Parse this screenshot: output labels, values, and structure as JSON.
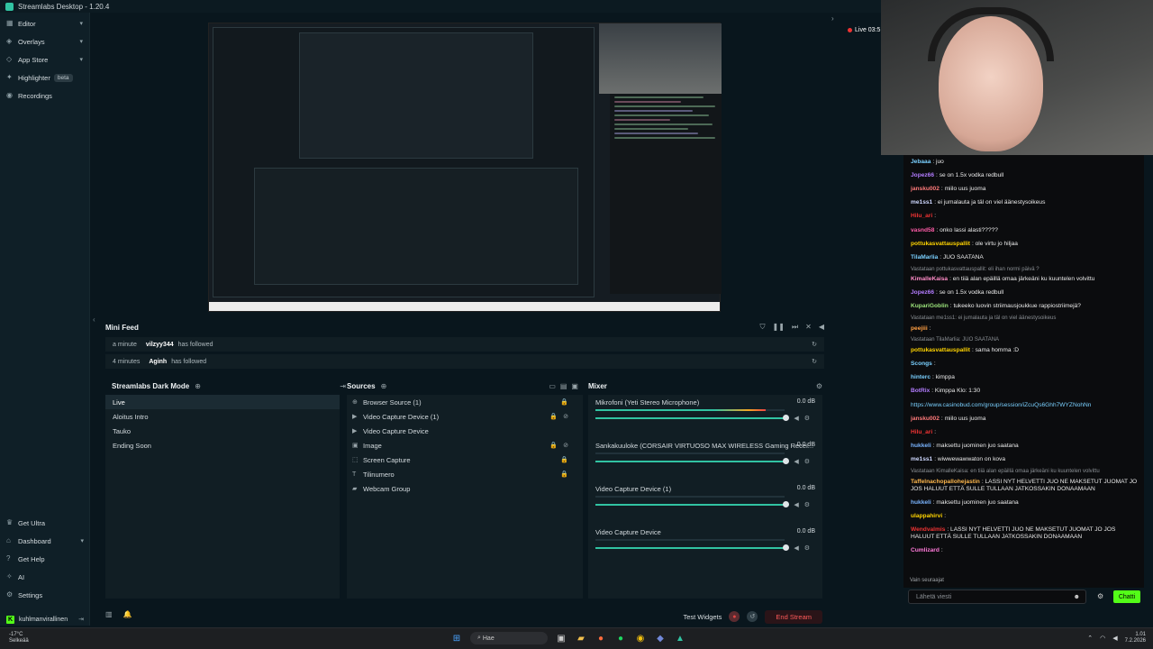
{
  "app": {
    "title": "Streamlabs Desktop - 1.20.4"
  },
  "sidebar": {
    "items": [
      {
        "label": "Editor",
        "icon": "editor-icon"
      },
      {
        "label": "Overlays",
        "icon": "overlays-icon"
      },
      {
        "label": "App Store",
        "icon": "store-icon"
      },
      {
        "label": "Highlighter",
        "icon": "highlighter-icon",
        "badge": "beta"
      },
      {
        "label": "Recordings",
        "icon": "recordings-icon"
      }
    ],
    "bottom": [
      {
        "label": "Get Ultra"
      },
      {
        "label": "Dashboard"
      },
      {
        "label": "Get Help"
      },
      {
        "label": "AI"
      },
      {
        "label": "Settings"
      }
    ],
    "user": "kuhlmanvirallinen"
  },
  "minifeed": {
    "title": "Mini Feed",
    "events": [
      {
        "time": "a minute",
        "user": "vilzyy344",
        "text": "has followed"
      },
      {
        "time": "4 minutes",
        "user": "Aginh",
        "text": "has followed"
      }
    ]
  },
  "scenes": {
    "title": "Streamlabs Dark Mode",
    "items": [
      "Live",
      "Aloitus Intro",
      "Tauko",
      "Ending Soon"
    ]
  },
  "sources": {
    "title": "Sources",
    "items": [
      "Browser Source (1)",
      "Video Capture Device (1)",
      "Video Capture Device",
      "Image",
      "Screen Capture",
      "Tilinumero",
      "Webcam Group"
    ]
  },
  "mixer": {
    "title": "Mixer",
    "channels": [
      {
        "name": "Mikrofoni (Yeti Stereo Microphone)",
        "db": "0.0 dB",
        "level": 0.9
      },
      {
        "name": "Sankakuuloke (CORSAIR VIRTUOSO MAX WIRELESS Gaming Recei...",
        "db": "0.0 dB",
        "level": 0.0
      },
      {
        "name": "Video Capture Device (1)",
        "db": "0.0 dB",
        "level": 0.0
      },
      {
        "name": "Video Capture Device",
        "db": "0.0 dB",
        "level": 0.0
      }
    ]
  },
  "footer": {
    "test_widgets": "Test Widgets",
    "end_stream": "End Stream"
  },
  "overlay": {
    "live": "Live 03:5"
  },
  "chat": {
    "messages": [
      {
        "user": "Jebaaa",
        "color": "#7ad0ff",
        "text": "juo"
      },
      {
        "user": "Jopez66",
        "color": "#b37cff",
        "text": "se on 1.5x vodka redbull"
      },
      {
        "user": "jansku002",
        "color": "#ff7a7a",
        "text": "miilo uus juoma"
      },
      {
        "user": "me1ss1",
        "color": "#cfd8ff",
        "text": "ei jumalauta ja täl on viel äänestysoikeus"
      },
      {
        "user": "Hilu_ari",
        "color": "#e33",
        "text": ""
      },
      {
        "user": "vasnd58",
        "color": "#ff5ca8",
        "text": "onko lassi alasti?????"
      },
      {
        "user": "pottukasvattauspallit",
        "color": "#ffd400",
        "text": "ole virtu jo hiljaa"
      },
      {
        "user": "TilaMarlia",
        "color": "#7ad0ff",
        "text": "JUO SAATANA"
      },
      {
        "reply": "Vastataan pottukasvattauspallit: eli ihan normi päivä ?"
      },
      {
        "user": "KimalleKaisa",
        "color": "#ff8cc8",
        "text": "en tiiä alan epäillä omaa järkeäni ku kuuntelen volvittu"
      },
      {
        "user": "Jopez66",
        "color": "#b37cff",
        "text": "se on 1.5x vodka redbull"
      },
      {
        "user": "KupariGoblin",
        "color": "#9be37b",
        "text": "tukeeko luovin striimausjoukkue rappiostriimejä?"
      },
      {
        "reply": "Vastataan me1ss1: ei jumalauta ja täl on viel äänestysoikeus"
      },
      {
        "user": "peejiii",
        "color": "#ff9f43",
        "text": ""
      },
      {
        "reply": "Vastataan TilaMarlia:  JUO SAATANA"
      },
      {
        "user": "pottukasvattauspallit",
        "color": "#ffd400",
        "text": "sama homma :D"
      },
      {
        "user": "Scongs",
        "color": "#7ad0ff",
        "text": ""
      },
      {
        "user": "hinterc",
        "color": "#7ad0ff",
        "text": "kimppa"
      },
      {
        "user": "BotRix",
        "color": "#b37cff",
        "text": "Kimppa Klo: 1:30"
      },
      {
        "user": "",
        "color": "#7ad0ff",
        "text": "https://www.casinobud.com/group/session/iZcuQs6Ghh7WYZNohNn"
      },
      {
        "user": "jansku002",
        "color": "#ff7a7a",
        "text": "miilo uus juoma"
      },
      {
        "user": "Hilu_ari",
        "color": "#e33",
        "text": ""
      },
      {
        "user": "hukkeli",
        "color": "#7ab4ff",
        "text": "maksettu juominen juo saatana"
      },
      {
        "user": "me1ss1",
        "color": "#cfd8ff",
        "text": "wiwwewawwaton on kova"
      },
      {
        "reply": "Vastataan KimalleKaisa: en tiiä alan epäillä omaa järkeäni ku kuuntelen volvittu"
      },
      {
        "user": "Taffelnachopallohejastin",
        "color": "#ffb84d",
        "text": "LASSI NYT HELVETTI JUO NE MAKSETUT JUOMAT JO JOS HALUUT ETTÄ SULLE TULLAAN JATKOSSAKIN DONAAMAAN"
      },
      {
        "user": "hukkeli",
        "color": "#7ab4ff",
        "text": "maksettu juominen juo saatana"
      },
      {
        "user": "ulappahirvi",
        "color": "#ffd400",
        "text": ""
      },
      {
        "user": "Wendvalmis",
        "color": "#e33",
        "text": "LASSI NYT HELVETTI JUO NE MAKSETUT JUOMAT JO JOS HALUUT ETTÄ SULLE TULLAAN JATKOSSAKIN DONAAMAAN"
      },
      {
        "user": "Cumlizard",
        "color": "#ff7ad9",
        "text": ""
      }
    ],
    "followers_only": "Vain seuraajat",
    "input_placeholder": "Lähetä viesti",
    "send_label": "Chatti"
  },
  "taskbar": {
    "weather_temp": "-17°C",
    "weather_text": "Selkeää",
    "search_placeholder": "Hae",
    "time": "1.01",
    "date": "7.2.2026"
  }
}
